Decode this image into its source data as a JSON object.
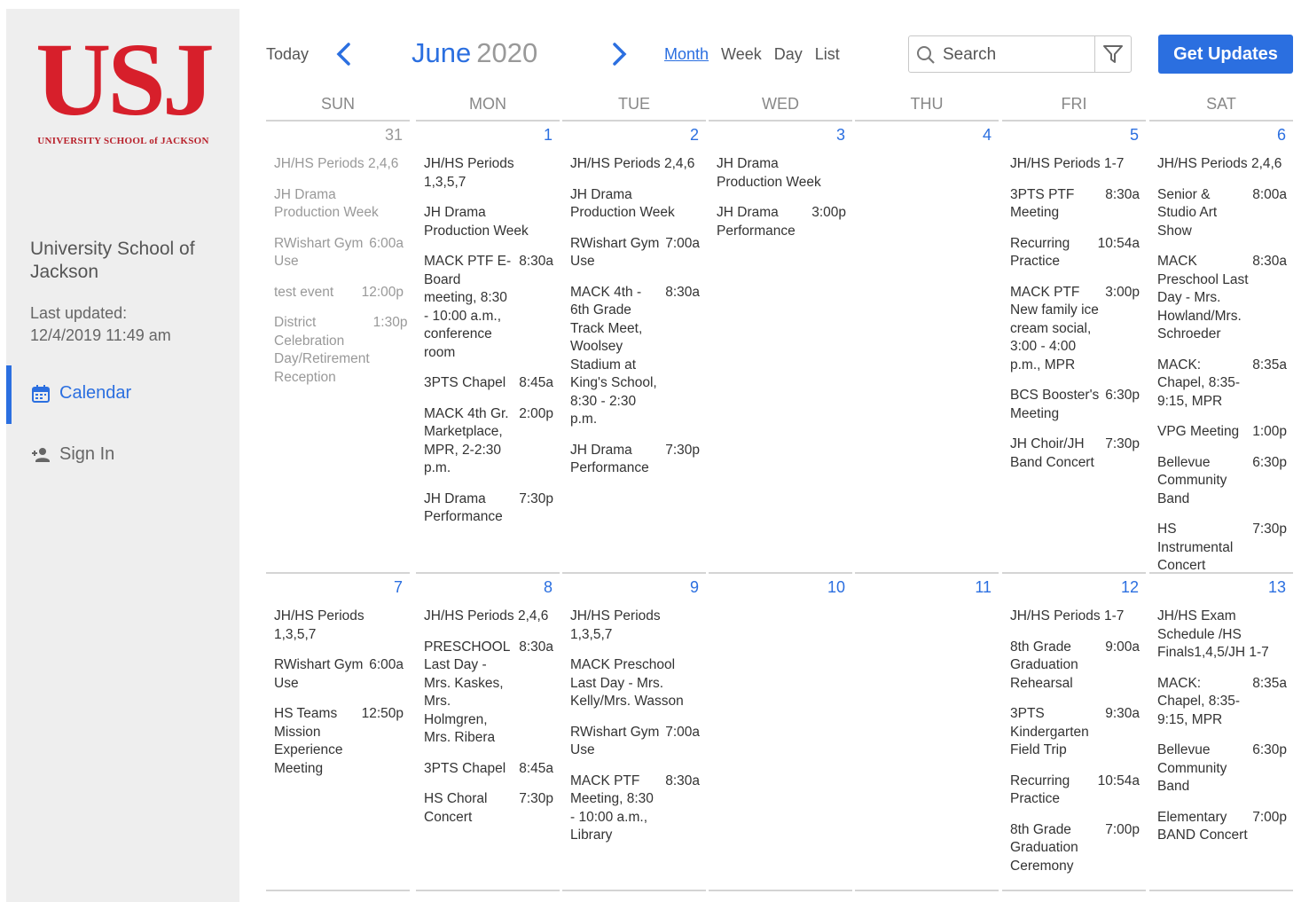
{
  "sidebar": {
    "logo_text": "USJ",
    "logo_sub": "UNIVERSITY SCHOOL of JACKSON",
    "org_name": "University School of Jackson",
    "updated_label": "Last updated:",
    "updated_value": "12/4/2019 11:49 am",
    "nav": [
      {
        "label": "Calendar",
        "icon": "calendar-icon",
        "active": true
      },
      {
        "label": "Sign In",
        "icon": "sign-in-icon",
        "active": false
      }
    ]
  },
  "toolbar": {
    "today": "Today",
    "month": "June",
    "year": "2020",
    "views": [
      "Month",
      "Week",
      "Day",
      "List"
    ],
    "active_view": "Month",
    "search_placeholder": "Search",
    "get_updates": "Get Updates"
  },
  "colors": {
    "accent": "#2b6fe0",
    "brand_red": "#d71f2b",
    "sidebar_bg": "#eeeeee"
  },
  "days_of_week": [
    "SUN",
    "MON",
    "TUE",
    "WED",
    "THU",
    "FRI",
    "SAT"
  ],
  "weeks": [
    [
      {
        "day": "31",
        "out": true,
        "events": [
          {
            "title": "JH/HS Periods 2,4,6",
            "time": ""
          },
          {
            "title": "JH Drama Production Week",
            "time": ""
          },
          {
            "title": "RWishart Gym Use",
            "time": "6:00a"
          },
          {
            "title": "test event",
            "time": "12:00p"
          },
          {
            "title": "District Celebration Day/Retirement Reception",
            "time": "1:30p"
          }
        ]
      },
      {
        "day": "1",
        "events": [
          {
            "title": "JH/HS Periods 1,3,5,7",
            "time": ""
          },
          {
            "title": "JH Drama Production Week",
            "time": ""
          },
          {
            "title": "MACK PTF E-Board meeting, 8:30 - 10:00 a.m., conference room",
            "time": "8:30a"
          },
          {
            "title": "3PTS Chapel",
            "time": "8:45a"
          },
          {
            "title": "MACK 4th Gr. Marketplace, MPR, 2-2:30 p.m.",
            "time": "2:00p"
          },
          {
            "title": "JH Drama Performance",
            "time": "7:30p"
          }
        ]
      },
      {
        "day": "2",
        "events": [
          {
            "title": "JH/HS Periods 2,4,6",
            "time": ""
          },
          {
            "title": "JH Drama Production Week",
            "time": ""
          },
          {
            "title": "RWishart Gym Use",
            "time": "7:00a"
          },
          {
            "title": "MACK 4th - 6th Grade Track Meet, Woolsey Stadium at King's School, 8:30 - 2:30 p.m.",
            "time": "8:30a"
          },
          {
            "title": "JH Drama Performance",
            "time": "7:30p"
          }
        ]
      },
      {
        "day": "3",
        "events": [
          {
            "title": "JH Drama Production Week",
            "time": ""
          },
          {
            "title": "JH Drama Performance",
            "time": "3:00p"
          }
        ]
      },
      {
        "day": "4",
        "events": []
      },
      {
        "day": "5",
        "events": [
          {
            "title": "JH/HS Periods 1-7",
            "time": ""
          },
          {
            "title": "3PTS PTF Meeting",
            "time": "8:30a"
          },
          {
            "title": "Recurring Practice",
            "time": "10:54a"
          },
          {
            "title": "MACK PTF New family ice cream social, 3:00 - 4:00 p.m., MPR",
            "time": "3:00p"
          },
          {
            "title": "BCS Booster's Meeting",
            "time": "6:30p"
          },
          {
            "title": "JH Choir/JH Band Concert",
            "time": "7:30p"
          }
        ]
      },
      {
        "day": "6",
        "events": [
          {
            "title": "JH/HS Periods 2,4,6",
            "time": ""
          },
          {
            "title": "Senior & Studio Art Show",
            "time": "8:00a"
          },
          {
            "title": "MACK Preschool Last Day - Mrs. Howland/Mrs. Schroeder",
            "time": "8:30a"
          },
          {
            "title": "MACK: Chapel, 8:35-9:15, MPR",
            "time": "8:35a"
          },
          {
            "title": "VPG Meeting",
            "time": "1:00p"
          },
          {
            "title": "Bellevue Community Band",
            "time": "6:30p"
          },
          {
            "title": "HS Instrumental Concert",
            "time": "7:30p"
          }
        ]
      }
    ],
    [
      {
        "day": "7",
        "events": [
          {
            "title": "JH/HS Periods 1,3,5,7",
            "time": ""
          },
          {
            "title": "RWishart Gym Use",
            "time": "6:00a"
          },
          {
            "title": "HS Teams Mission Experience Meeting",
            "time": "12:50p"
          }
        ]
      },
      {
        "day": "8",
        "events": [
          {
            "title": "JH/HS Periods 2,4,6",
            "time": ""
          },
          {
            "title": "PRESCHOOL Last Day - Mrs. Kaskes, Mrs. Holmgren, Mrs. Ribera",
            "time": "8:30a"
          },
          {
            "title": "3PTS Chapel",
            "time": "8:45a"
          },
          {
            "title": "HS Choral Concert",
            "time": "7:30p"
          }
        ]
      },
      {
        "day": "9",
        "events": [
          {
            "title": "JH/HS Periods 1,3,5,7",
            "time": ""
          },
          {
            "title": "MACK Preschool Last Day - Mrs. Kelly/Mrs. Wasson",
            "time": ""
          },
          {
            "title": "RWishart Gym Use",
            "time": "7:00a"
          },
          {
            "title": "MACK PTF Meeting, 8:30 - 10:00 a.m., Library",
            "time": "8:30a"
          }
        ]
      },
      {
        "day": "10",
        "events": []
      },
      {
        "day": "11",
        "events": []
      },
      {
        "day": "12",
        "events": [
          {
            "title": "JH/HS Periods 1-7",
            "time": ""
          },
          {
            "title": "8th Grade Graduation Rehearsal",
            "time": "9:00a"
          },
          {
            "title": "3PTS Kindergarten Field Trip",
            "time": "9:30a"
          },
          {
            "title": "Recurring Practice",
            "time": "10:54a"
          },
          {
            "title": "8th Grade Graduation Ceremony",
            "time": "7:00p"
          }
        ]
      },
      {
        "day": "13",
        "events": [
          {
            "title": "JH/HS Exam Schedule /HS Finals1,4,5/JH 1-7",
            "time": ""
          },
          {
            "title": "MACK: Chapel, 8:35-9:15, MPR",
            "time": "8:35a"
          },
          {
            "title": "Bellevue Community Band",
            "time": "6:30p"
          },
          {
            "title": "Elementary BAND Concert",
            "time": "7:00p"
          }
        ]
      }
    ]
  ]
}
